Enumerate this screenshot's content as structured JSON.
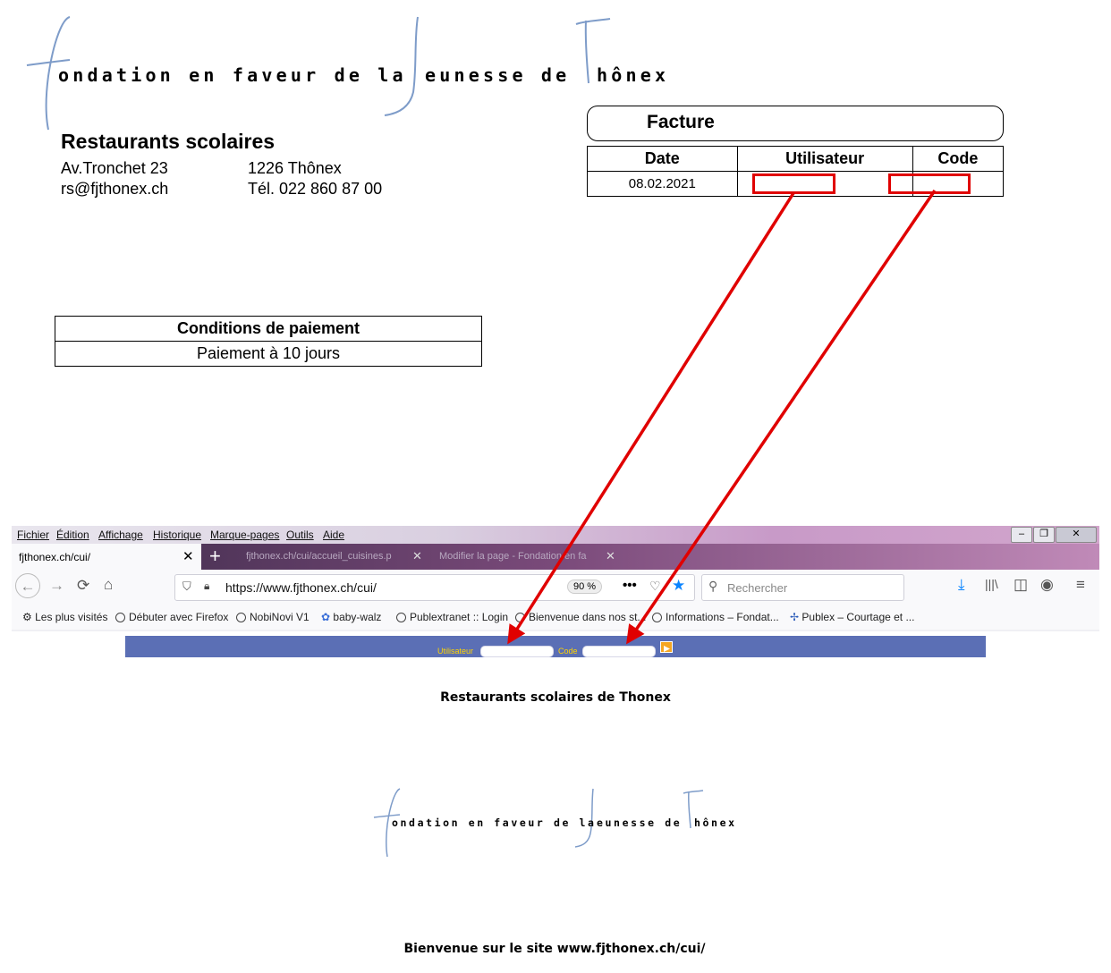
{
  "logo": {
    "f": "f",
    "part1": "ondation en faveur de la",
    "j": "j",
    "part2": "eunesse de",
    "t": "T",
    "part3": "hônex"
  },
  "letterhead": {
    "title": "Restaurants scolaires",
    "street": "Av.Tronchet 23",
    "city": "1226 Thônex",
    "email": "rs@fjthonex.ch",
    "phone": "Tél. 022 860 87 00"
  },
  "invoice": {
    "title": "Facture",
    "headers": [
      "Date",
      "Utilisateur",
      "Code"
    ],
    "date": "08.02.2021",
    "user": "",
    "code": ""
  },
  "payment": {
    "header": "Conditions de paiement",
    "terms": "Paiement à 10 jours"
  },
  "browser": {
    "menu": [
      "Fichier",
      "Édition",
      "Affichage",
      "Historique",
      "Marque-pages",
      "Outils",
      "Aide"
    ],
    "active_tab": "fjthonex.ch/cui/",
    "inactive_tabs": [
      "fjthonex.ch/cui/accueil_cuisines.p",
      "Modifier la page - Fondation en fa"
    ],
    "url": "https://www.fjthonex.ch/cui/",
    "zoom": "90 %",
    "search_placeholder": "Rechercher",
    "bookmarks": [
      "Les plus visités",
      "Débuter avec Firefox",
      "NobiNovi V1",
      "baby-walz",
      "Publextranet :: Login",
      "Bienvenue dans nos st...",
      "Informations – Fondat...",
      "Publex – Courtage et ..."
    ]
  },
  "site": {
    "user_label": "Utilisateur",
    "code_label": "Code",
    "heading": "Restaurants scolaires de Thonex",
    "welcome": "Bienvenue sur le site www.fjthonex.ch/cui/"
  },
  "colors": {
    "annotation_red": "#e00000",
    "site_bar": "#5b6fb5",
    "site_label": "#ffd400",
    "logo_stroke": "#7e9cc9"
  }
}
